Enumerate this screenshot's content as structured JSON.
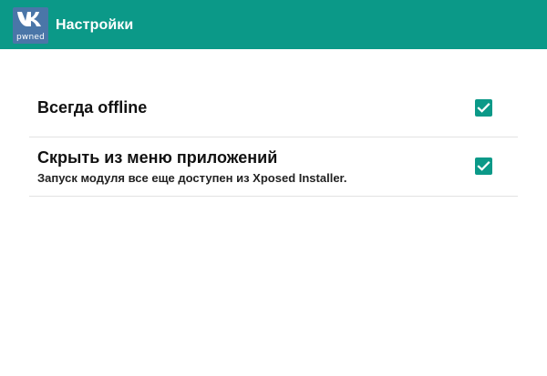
{
  "appbar": {
    "icon": "vk-pwned-logo-icon",
    "icon_subtext": "pwned",
    "title": "Настройки",
    "background_color": "#0b9988"
  },
  "settings": [
    {
      "title": "Всегда offline",
      "summary": "",
      "checked": true
    },
    {
      "title": "Скрыть из меню приложений",
      "summary": "Запуск модуля все еще доступен из Xposed Installer.",
      "checked": true
    }
  ],
  "colors": {
    "accent": "#0b9988",
    "icon_bg": "#4a76a8",
    "divider": "#e2e2e2"
  }
}
